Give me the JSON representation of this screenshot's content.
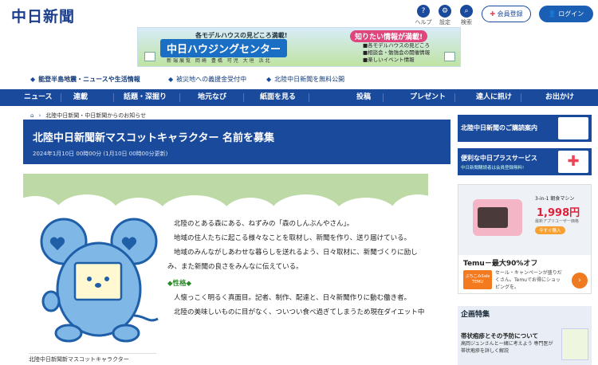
{
  "header": {
    "logo": "中日新聞",
    "help": "ヘルプ",
    "settings": "設定",
    "search": "検索",
    "register": "会員登録",
    "login": "ログイン"
  },
  "ad_top": {
    "line1": "各モデルハウスの見どころ満載!",
    "title": "中日ハウジングセンター",
    "places": "新瑞展覧 岡崎 豊橋 可児 大垣 浜北",
    "badge": "知りたい情報が満載!",
    "item1": "■各モデルハウスの見どころ",
    "item2": "■相談会・勉強会の開催情報",
    "item3": "■楽しいイベント情報"
  },
  "alerts": [
    "能登半島地震・ニュースや生活情報",
    "被災地への義援金受付中",
    "北陸中日新聞を無料公開"
  ],
  "nav": [
    "ニュース",
    "連載",
    "話題・深掘り",
    "地元なび",
    "紙面を見る",
    "投稿",
    "プレゼント",
    "達人に訊け",
    "お出かけ"
  ],
  "breadcrumb": "北陸中日新聞・中日新聞からのお知らせ",
  "article": {
    "title": "北陸中日新聞新マスコットキャラクター 名前を募集",
    "date": "2024年1月10日 00時00分 (1月10日 00時00分更新)",
    "caption": "北陸中日新聞新マスコットキャラクター",
    "paras": [
      "北陸のとある森にある、ねずみの「森のしんぶんやさん」。",
      "地域の住人たちに起こる様々なことを取材し、新聞を作り、送り届けている。",
      "地域のみんながしあわせな暮らしを送れるよう、日々取材に、新聞づくりに励しみ、また新聞の良さをみんなに伝えている。"
    ],
    "section": "◆性格◆",
    "paras2": [
      "人懐っこく明るく真面目。記者、制作、配達と、日々新聞作りに動む働き者。",
      "北陸の美味しいものに目がなく、ついつい食べ過ぎてしまうため現在ダイエット中"
    ]
  },
  "sidebar": {
    "btn1": "北陸中日新聞のご購読案内",
    "btn2": "便利な中日プラスサービス",
    "btn2_sub": "中日新聞購読者は会員登録無料!",
    "ad": {
      "product": "3-in-1 朝食マシン",
      "price": "1,998円",
      "note": "最新アプリユーザー価格",
      "cta": "今すぐ購入",
      "title": "Temu－最大90%オフ",
      "logo": "ぶちこみSale TEMU",
      "desc": "セール・キャンペーンが盛りだくさん。Temuでお得にショッピングを。"
    },
    "feature_head": "企画特集",
    "feature_title": "帯状疱疹とその予防について",
    "feature_desc": "高岡ジュンさんと一緒に考えよう 専門医が帯状疱疹を詳しく解説"
  }
}
